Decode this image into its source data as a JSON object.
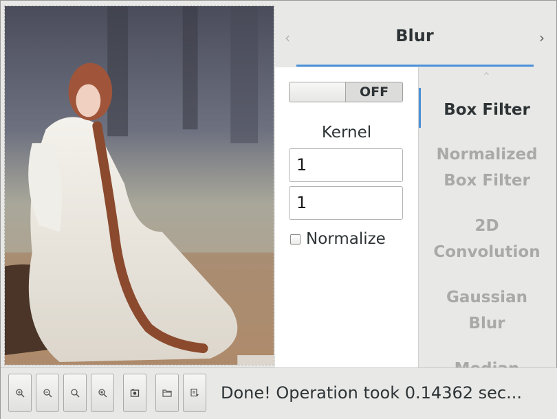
{
  "header": {
    "title": "Blur",
    "prev_icon": "chevron-left-icon",
    "next_icon": "chevron-right-icon"
  },
  "controls": {
    "toggle_state": "OFF",
    "kernel_label": "Kernel",
    "kernel_x": "1",
    "kernel_y": "1",
    "minus_label": "−",
    "plus_label": "+",
    "normalize_label": "Normalize",
    "normalize_checked": false
  },
  "filters": {
    "items": [
      {
        "line1": "Box Filter",
        "line2": ""
      },
      {
        "line1": "Normalized",
        "line2": "Box Filter"
      },
      {
        "line1": "2D",
        "line2": "Convolution"
      },
      {
        "line1": "Gaussian",
        "line2": "Blur"
      },
      {
        "line1": "Median",
        "line2": ""
      }
    ],
    "active_index": 0
  },
  "toolbar": {
    "buttons": [
      "zoom-in-icon",
      "zoom-out-icon",
      "zoom-fit-icon",
      "zoom-original-icon",
      "camera-icon",
      "folder-open-icon",
      "save-icon"
    ],
    "status": "Done! Operation took 0.14362 sec..."
  },
  "colors": {
    "accent": "#4a90d9",
    "panel": "#e8e8e7",
    "text": "#2e3436",
    "inactive_text": "#a9a9a7"
  }
}
